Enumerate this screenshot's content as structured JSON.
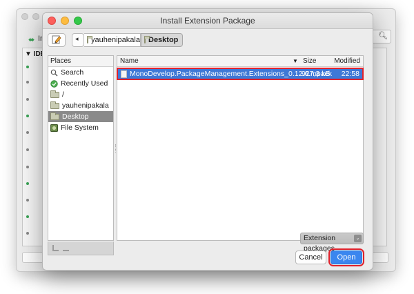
{
  "background_window": {
    "toolbar_label": "In",
    "tree_label": "▼ IDE"
  },
  "dialog": {
    "title": "Install Extension Package"
  },
  "path_bar": {
    "back_glyph": "◂",
    "crumbs": [
      "yauhenipakala",
      "Desktop"
    ]
  },
  "places": {
    "header": "Places",
    "items": [
      {
        "label": "Search",
        "icon": "magnifier-icon"
      },
      {
        "label": "Recently Used",
        "icon": "recent-icon"
      },
      {
        "label": "/",
        "icon": "folder-icon"
      },
      {
        "label": "yauhenipakala",
        "icon": "folder-icon"
      },
      {
        "label": "Desktop",
        "icon": "folder-icon",
        "selected": true
      },
      {
        "label": "File System",
        "icon": "drive-icon"
      }
    ]
  },
  "files": {
    "columns": {
      "name": "Name",
      "size": "Size",
      "modified": "Modified"
    },
    "sort_indicator": "▼",
    "rows": [
      {
        "name": "MonoDevelop.PackageManagement.Extensions_0.12.6.mpack",
        "size": "927,3 kB",
        "modified": "22:58",
        "selected": true
      }
    ]
  },
  "filter": {
    "selected": "Extension packages",
    "caret": "⌄"
  },
  "buttons": {
    "cancel": "Cancel",
    "open": "Open"
  },
  "colors": {
    "selection": "#3e78d6",
    "primary_button": "#3a86ef",
    "highlight_box": "#e0212b",
    "place_selected": "#8a8a8a"
  }
}
